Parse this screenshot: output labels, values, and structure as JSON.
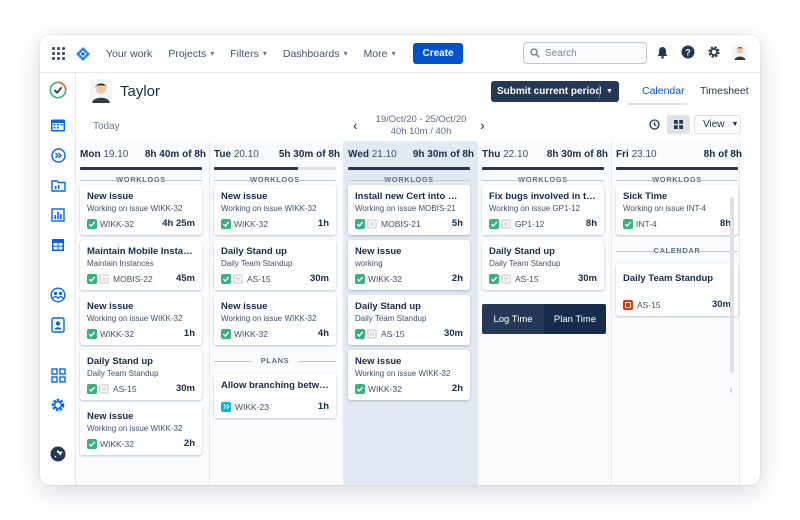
{
  "nav": {
    "items": [
      {
        "label": "Your work",
        "chevron": false
      },
      {
        "label": "Projects",
        "chevron": true
      },
      {
        "label": "Filters",
        "chevron": true
      },
      {
        "label": "Dashboards",
        "chevron": true
      },
      {
        "label": "More",
        "chevron": true
      }
    ],
    "create_label": "Create",
    "search_placeholder": "Search"
  },
  "header": {
    "user_name": "Taylor",
    "submit_label": "Submit current period",
    "tabs": [
      "Calendar",
      "Timesheet"
    ],
    "today_label": "Today",
    "range_dates": "19/Oct/20 - 25/Oct/20",
    "range_hours": "40h 10m / 40h",
    "view_label": "View"
  },
  "section_labels": {
    "worklogs": "WORKLOGS",
    "plans": "PLANS",
    "calendar": "CALENDAR"
  },
  "columns": [
    {
      "day": "Mon",
      "date": "19.10",
      "total": "8h 40m of 8h",
      "progress": 1.0,
      "cards": [
        {
          "title": "New issue",
          "sub": "Working on issue WIKK-32",
          "key": "WIKK-32",
          "time": "4h 25m",
          "type": "check"
        },
        {
          "title": "Maintain Mobile Instance",
          "sub": "Maintain Instances",
          "key": "MOBIS-22",
          "time": "45m",
          "type": "check-sub"
        },
        {
          "title": "New issue",
          "sub": "Working on issue WIKK-32",
          "key": "WIKK-32",
          "time": "1h",
          "type": "check"
        },
        {
          "title": "Daily Stand up",
          "sub": "Daily Team Standup",
          "key": "AS-15",
          "time": "30m",
          "type": "check-sub"
        },
        {
          "title": "New issue",
          "sub": "Working on issue WIKK-32",
          "key": "WIKK-32",
          "time": "2h",
          "type": "check"
        }
      ]
    },
    {
      "day": "Tue",
      "date": "20.10",
      "total": "5h 30m of 8h",
      "progress": 0.69,
      "cards": [
        {
          "title": "New issue",
          "sub": "Working on issue WIKK-32",
          "key": "WIKK-32",
          "time": "1h",
          "type": "check"
        },
        {
          "title": "Daily Stand up",
          "sub": "Daily Team Standup",
          "key": "AS-15",
          "time": "30m",
          "type": "check-sub"
        },
        {
          "title": "New issue",
          "sub": "Working on issue WIKK-32",
          "key": "WIKK-32",
          "time": "4h",
          "type": "check"
        }
      ],
      "plans": [
        {
          "title": "Allow branching betwee…",
          "key": "WIKK-23",
          "time": "1h"
        }
      ]
    },
    {
      "day": "Wed",
      "date": "21.10",
      "total": "9h 30m of 8h",
      "progress": 1.0,
      "cards": [
        {
          "title": "Install new Cert into our…",
          "sub": "Working on issue MOBIS-21",
          "key": "MOBIS-21",
          "time": "5h",
          "type": "check-sub"
        },
        {
          "title": "New issue",
          "sub": "working",
          "key": "WIKK-32",
          "time": "2h",
          "type": "check"
        },
        {
          "title": "Daily Stand up",
          "sub": "Daily Team Standup",
          "key": "AS-15",
          "time": "30m",
          "type": "check-sub"
        },
        {
          "title": "New issue",
          "sub": "Working on issue WIKK-32",
          "key": "WIKK-32",
          "time": "2h",
          "type": "check"
        }
      ]
    },
    {
      "day": "Thu",
      "date": "22.10",
      "total": "8h 30m of 8h",
      "progress": 1.0,
      "cards": [
        {
          "title": "Fix bugs involved in the …",
          "sub": "Working on issue GP1-12",
          "key": "GP1-12",
          "time": "8h",
          "type": "check-sub"
        },
        {
          "title": "Daily Stand up",
          "sub": "Daily Team Standup",
          "key": "AS-15",
          "time": "30m",
          "type": "check-sub"
        }
      ],
      "log_time_label": "Log Time",
      "plan_time_label": "Plan Time"
    },
    {
      "day": "Fri",
      "date": "23.10",
      "total": "8h of 8h",
      "progress": 1.0,
      "cards": [
        {
          "title": "Sick Time",
          "sub": "Working on issue INT-4",
          "key": "INT-4",
          "time": "8h",
          "type": "check"
        }
      ],
      "calendar": [
        {
          "title": "Daily Team Standup",
          "key": "AS-15",
          "time": "30m"
        }
      ]
    }
  ],
  "colors": {
    "primary": "#0052cc",
    "dark_navy": "#253858",
    "success": "#36b37e",
    "wed_highlight": "#e1e9f2"
  }
}
